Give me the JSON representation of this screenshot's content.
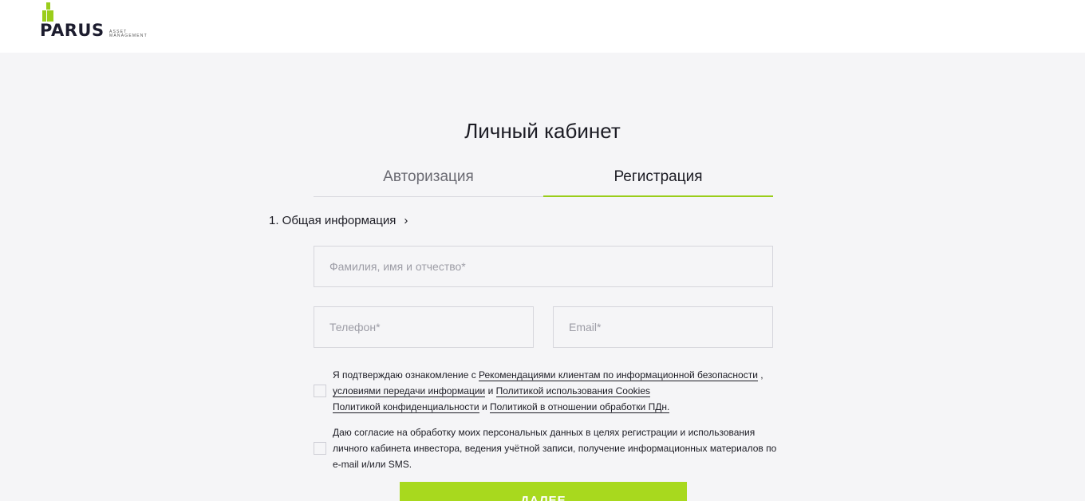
{
  "header": {
    "logo_text": "PARUS",
    "logo_sub": "ASSET MANAGEMENT",
    "brand_color": "#9acd1a"
  },
  "page": {
    "title": "Личный кабинет"
  },
  "tabs": [
    {
      "label": "Авторизация",
      "active": false
    },
    {
      "label": "Регистрация",
      "active": true
    }
  ],
  "step": {
    "label": "1. Общая информация",
    "chevron": "›"
  },
  "form": {
    "full_name_placeholder": "Фамилия, имя и отчество*",
    "phone_placeholder": "Телефон*",
    "email_placeholder": "Email*",
    "consent1": {
      "text_1": "Я подтверждаю ознакомление с ",
      "link_1": "Рекомендациями клиентам по информационной безопасности",
      "text_2": " , ",
      "link_2": "условиями передачи информации",
      "text_3": " и ",
      "link_3": "Политикой использования Cookies",
      "text_4": " ",
      "link_4": "Политикой конфиденциальности",
      "text_5": " и ",
      "link_5": "Политикой в отношении обработки ПДн."
    },
    "consent2": {
      "text": "Даю согласие на обработку моих персональных данных в целях регистрации и использования личного кабинета инвестора, ведения учётной записи, получение информационных материалов по e-mail и/или SMS."
    },
    "submit_label": "ДАЛЕЕ",
    "button_color": "#a8d91e"
  }
}
